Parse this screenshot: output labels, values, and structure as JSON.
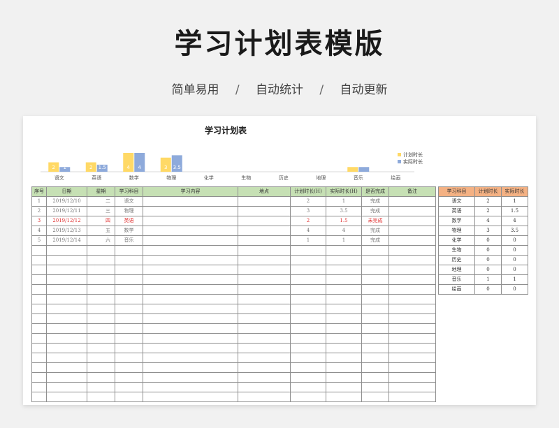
{
  "page": {
    "title": "学习计划表模版",
    "features": [
      "简单易用",
      "自动统计",
      "自动更新"
    ],
    "separator": "/"
  },
  "sheet": {
    "title": "学习计划表"
  },
  "colors": {
    "plan": "#ffd966",
    "actual": "#8eaadb",
    "header_green": "#c6e0b4",
    "header_orange": "#f4b183",
    "incomplete_red": "#e03030"
  },
  "chart_data": {
    "type": "bar",
    "categories": [
      "语文",
      "英语",
      "数学",
      "物理",
      "化学",
      "生物",
      "历史",
      "地理",
      "音乐",
      "绘画"
    ],
    "series": [
      {
        "name": "计划时长",
        "values": [
          2,
          2,
          4,
          3,
          0,
          0,
          0,
          0,
          1,
          0
        ]
      },
      {
        "name": "实际时长",
        "values": [
          1,
          1.5,
          4,
          3.5,
          0,
          0,
          0,
          0,
          1,
          0
        ]
      }
    ],
    "data_labels": [
      [
        "2",
        "2",
        "4",
        "3",
        "",
        "",
        "",
        "",
        "",
        ""
      ],
      [
        "1",
        "1.5",
        "4",
        "3.5",
        "",
        "",
        "",
        "",
        "",
        ""
      ]
    ],
    "ylim": [
      0,
      4
    ],
    "legend": "right",
    "grid": false
  },
  "main_table": {
    "headers": [
      "序号",
      "日期",
      "星期",
      "学习科目",
      "学习内容",
      "地点",
      "计划时长(H)",
      "实际时长(H)",
      "是否完成",
      "备注"
    ],
    "rows": [
      {
        "no": "1",
        "date": "2019/12/10",
        "weekday": "二",
        "subject": "语文",
        "content": "",
        "place": "",
        "plan": "2",
        "actual": "1",
        "done": "完成",
        "note": "",
        "highlight": false
      },
      {
        "no": "2",
        "date": "2019/12/11",
        "weekday": "三",
        "subject": "物理",
        "content": "",
        "place": "",
        "plan": "3",
        "actual": "3.5",
        "done": "完成",
        "note": "",
        "highlight": false
      },
      {
        "no": "3",
        "date": "2019/12/12",
        "weekday": "四",
        "subject": "英语",
        "content": "",
        "place": "",
        "plan": "2",
        "actual": "1.5",
        "done": "未完成",
        "note": "",
        "highlight": true
      },
      {
        "no": "4",
        "date": "2019/12/13",
        "weekday": "五",
        "subject": "数学",
        "content": "",
        "place": "",
        "plan": "4",
        "actual": "4",
        "done": "完成",
        "note": "",
        "highlight": false
      },
      {
        "no": "5",
        "date": "2019/12/14",
        "weekday": "六",
        "subject": "音乐",
        "content": "",
        "place": "",
        "plan": "1",
        "actual": "1",
        "done": "完成",
        "note": "",
        "highlight": false
      }
    ]
  },
  "summary_table": {
    "headers": [
      "学习科目",
      "计划时长",
      "实际时长"
    ],
    "rows": [
      [
        "语文",
        "2",
        "1"
      ],
      [
        "英语",
        "2",
        "1.5"
      ],
      [
        "数学",
        "4",
        "4"
      ],
      [
        "物理",
        "3",
        "3.5"
      ],
      [
        "化学",
        "0",
        "0"
      ],
      [
        "生物",
        "0",
        "0"
      ],
      [
        "历史",
        "0",
        "0"
      ],
      [
        "地理",
        "0",
        "0"
      ],
      [
        "音乐",
        "1",
        "1"
      ],
      [
        "绘画",
        "0",
        "0"
      ]
    ]
  }
}
